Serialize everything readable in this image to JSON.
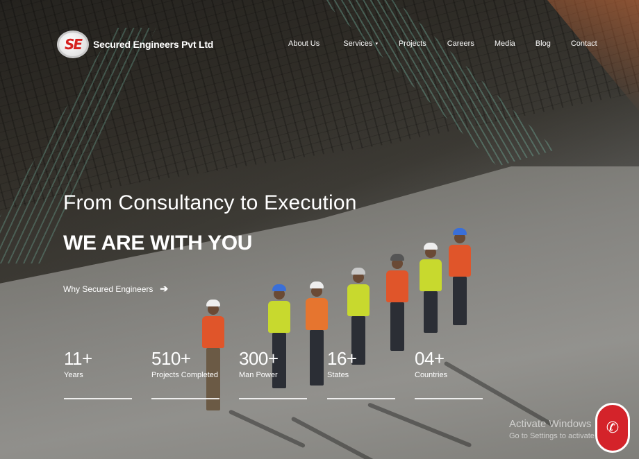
{
  "brand": {
    "logo_mark": "SE",
    "name": "Secured Engineers Pvt Ltd"
  },
  "nav": {
    "items": [
      {
        "label": "About Us"
      },
      {
        "label": "Services"
      },
      {
        "label": "Projects"
      },
      {
        "label": "Careers"
      },
      {
        "label": "Media"
      },
      {
        "label": "Blog"
      },
      {
        "label": "Contact"
      }
    ],
    "services_caret": "▾"
  },
  "hero": {
    "title": "From Consultancy to Execution",
    "subtitle": "WE ARE WITH YOU",
    "link_label": "Why Secured Engineers",
    "link_arrow": "➔"
  },
  "stats": [
    {
      "value": "11+",
      "label": "Years"
    },
    {
      "value": "510+",
      "label": "Projects Completed"
    },
    {
      "value": "300+",
      "label": "Man Power"
    },
    {
      "value": "16+",
      "label": "States"
    },
    {
      "value": "04+",
      "label": "Countries"
    }
  ],
  "watermark": {
    "line1": "Activate Windows",
    "line2": "Go to Settings to activate Windows."
  },
  "call_button": {
    "icon": "phone-icon",
    "glyph": "✆"
  },
  "colors": {
    "accent": "#d4232a",
    "text": "#ffffff"
  }
}
